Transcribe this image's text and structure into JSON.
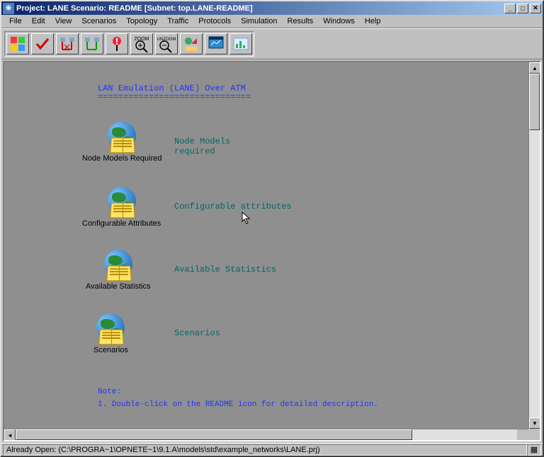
{
  "title": "Project: LANE Scenario: README  [Subnet: top.LANE-README]",
  "menu": [
    "File",
    "Edit",
    "View",
    "Scenarios",
    "Topology",
    "Traffic",
    "Protocols",
    "Simulation",
    "Results",
    "Windows",
    "Help"
  ],
  "toolbar_icons": [
    "palette-icon",
    "check-icon",
    "fail-links-icon",
    "recover-links-icon",
    "fail-node-icon",
    "zoom-in-icon",
    "zoom-out-icon",
    "run-sim-icon",
    "view-results-icon",
    "stats-icon"
  ],
  "toolbar_labels": [
    "",
    "",
    "",
    "",
    "",
    "ZOOM",
    "UNZOOM",
    "",
    "",
    ""
  ],
  "heading": "LAN Emulation (LANE) Over ATM",
  "heading_underline": "==============================",
  "items": [
    {
      "icon_label": "Node Models Required",
      "desk_label": "Node Models\nrequired"
    },
    {
      "icon_label": "Configurable Attributes",
      "desk_label": "Configurable attributes"
    },
    {
      "icon_label": "Available Statistics",
      "desk_label": "Available Statistics"
    },
    {
      "icon_label": "Scenarios",
      "desk_label": "Scenarios"
    }
  ],
  "note_head": "Note:",
  "note_body": "1. Double-click on the README icon for detailed description.",
  "status": "Already Open: (C:\\PROGRA~1\\OPNETE~1\\9.1.A\\models\\std\\example_networks\\LANE.prj)"
}
